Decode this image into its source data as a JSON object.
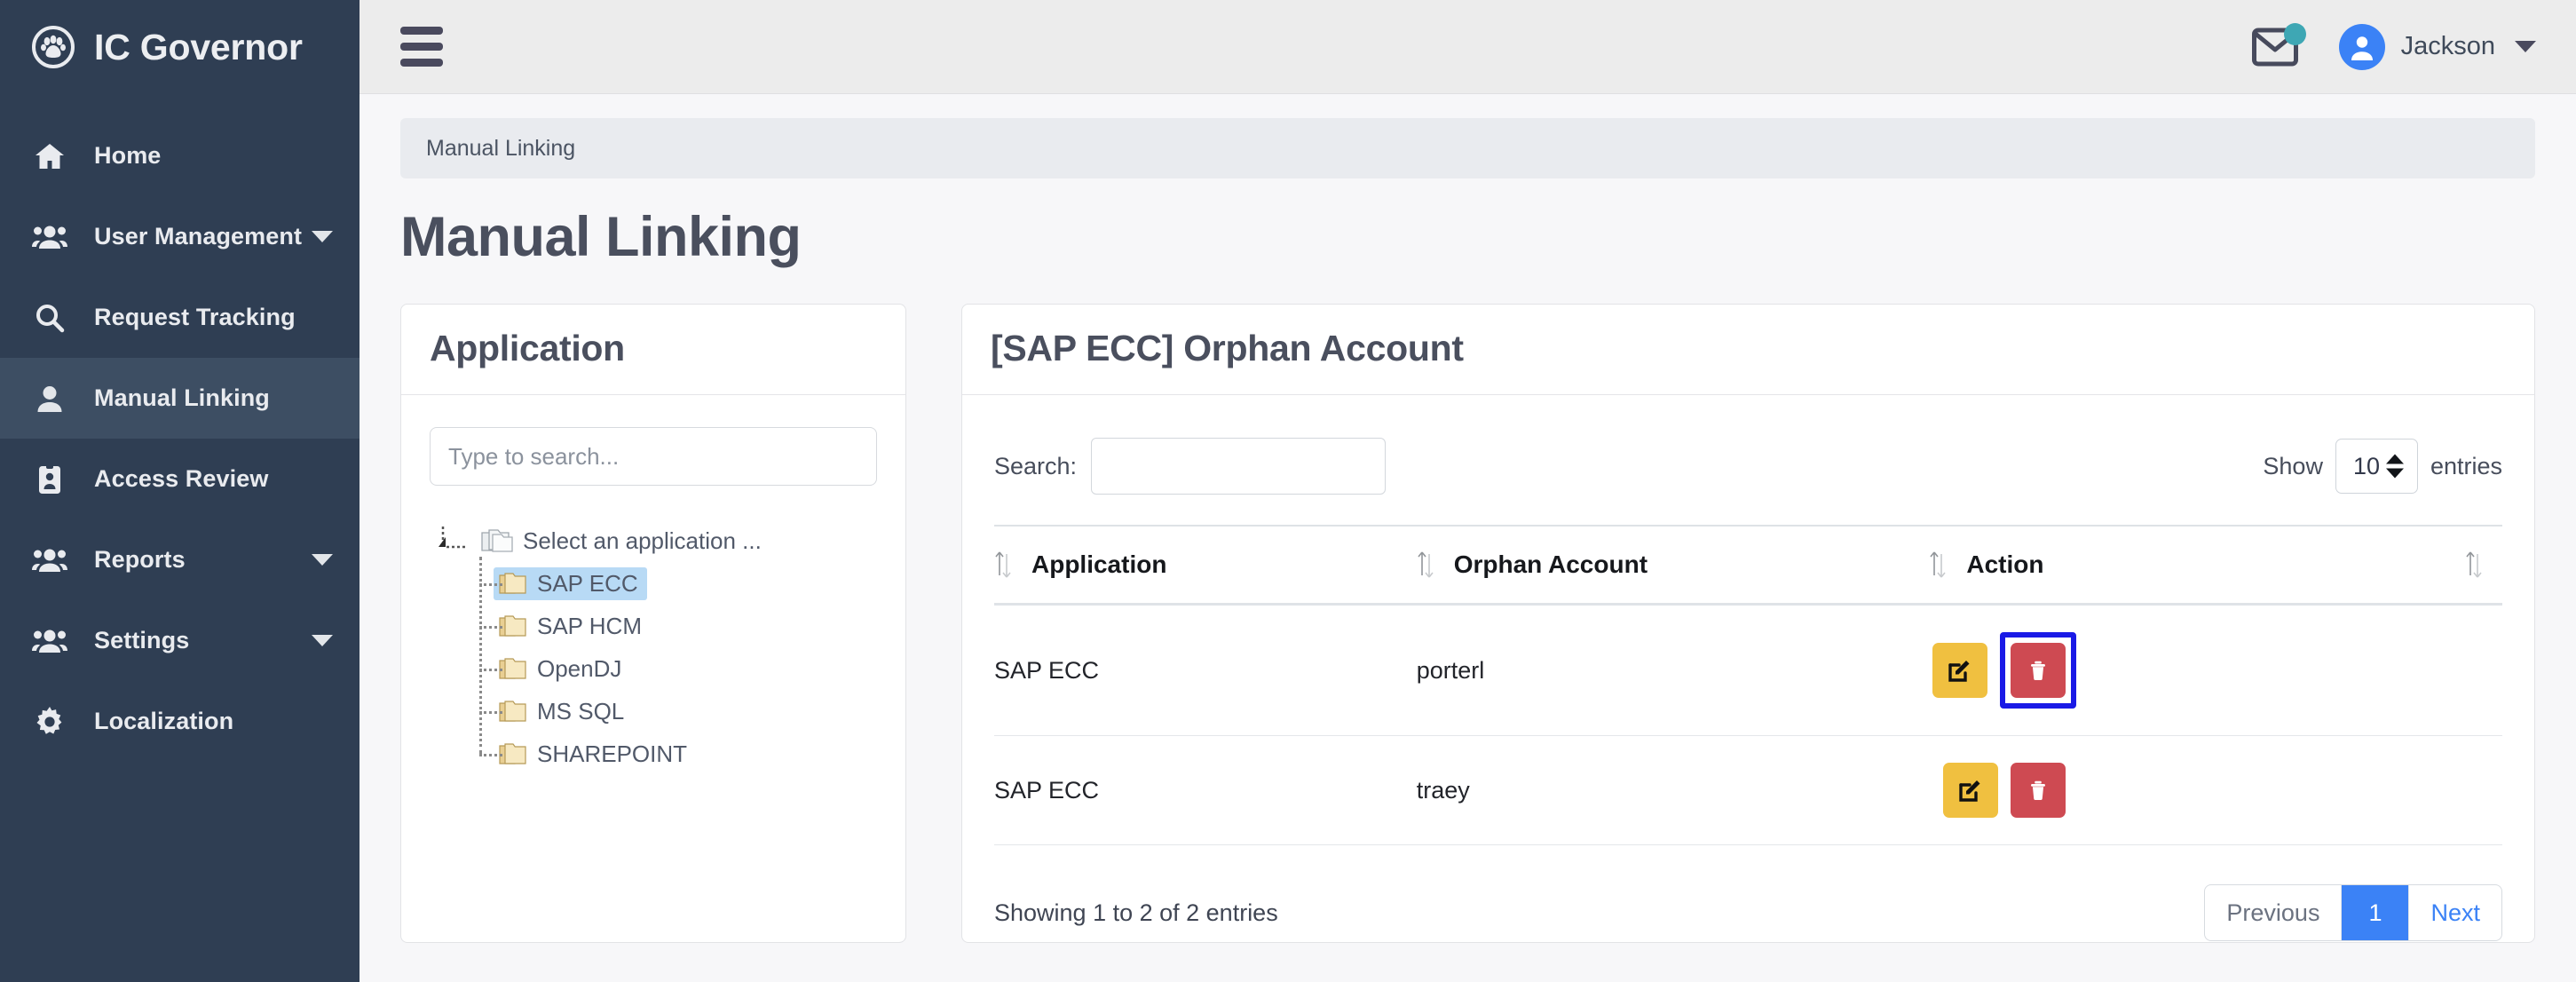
{
  "brand": {
    "title": "IC Governor",
    "logo_icon": "paw-circle-icon"
  },
  "sidebar": {
    "items": [
      {
        "label": "Home",
        "icon": "home-icon",
        "caret": false,
        "active": false
      },
      {
        "label": "User Management",
        "icon": "users-icon",
        "caret": true,
        "active": false
      },
      {
        "label": "Request Tracking",
        "icon": "search-icon",
        "caret": false,
        "active": false
      },
      {
        "label": "Manual Linking",
        "icon": "user-icon",
        "caret": false,
        "active": true
      },
      {
        "label": "Access Review",
        "icon": "id-badge-icon",
        "caret": false,
        "active": false
      },
      {
        "label": "Reports",
        "icon": "users-icon",
        "caret": true,
        "active": false
      },
      {
        "label": "Settings",
        "icon": "users-icon",
        "caret": true,
        "active": false
      },
      {
        "label": "Localization",
        "icon": "gear-icon",
        "caret": false,
        "active": false
      }
    ]
  },
  "topbar": {
    "menu_icon": "hamburger-icon",
    "mail_icon": "envelope-icon",
    "mail_badge_color": "#3ea7b4",
    "avatar_icon": "user-avatar-icon",
    "avatar_color": "#3b82f6",
    "user_name": "Jackson",
    "caret_icon": "chevron-down-icon"
  },
  "breadcrumb": {
    "text": "Manual Linking"
  },
  "page": {
    "title": "Manual Linking"
  },
  "application_panel": {
    "title": "Application",
    "search_placeholder": "Type to search...",
    "search_value": "",
    "tree": {
      "root_label": "Select an application ...",
      "nodes": [
        {
          "label": "SAP ECC",
          "selected": true
        },
        {
          "label": "SAP HCM",
          "selected": false
        },
        {
          "label": "OpenDJ",
          "selected": false
        },
        {
          "label": "MS SQL",
          "selected": false
        },
        {
          "label": "SHAREPOINT",
          "selected": false
        }
      ]
    }
  },
  "table_panel": {
    "title": "[SAP ECC] Orphan Account",
    "search_label": "Search:",
    "search_value": "",
    "show_label": "Show",
    "entries_label": "entries",
    "page_size": "10",
    "columns": [
      "Application",
      "Orphan Account",
      "Action",
      ""
    ],
    "rows": [
      {
        "application": "SAP ECC",
        "orphan_account": "porterl",
        "actions": [
          {
            "name": "edit",
            "icon": "pencil-square-icon",
            "color": "#f0c040",
            "focused": false
          },
          {
            "name": "delete",
            "icon": "trash-icon",
            "color": "#ce4a52",
            "focused": true
          }
        ]
      },
      {
        "application": "SAP ECC",
        "orphan_account": "traey",
        "actions": [
          {
            "name": "edit",
            "icon": "pencil-square-icon",
            "color": "#f0c040",
            "focused": false
          },
          {
            "name": "delete",
            "icon": "trash-icon",
            "color": "#ce4a52",
            "focused": false
          }
        ]
      }
    ],
    "showing_text": "Showing 1 to 2 of 2 entries",
    "pagination": {
      "previous": "Previous",
      "current": "1",
      "next": "Next"
    }
  },
  "colors": {
    "sidebar_bg": "#2f3e53",
    "sidebar_active_bg": "#3d4e63",
    "topbar_bg": "#ececec",
    "accent_blue": "#3b82f6",
    "focus_ring": "#1a1ae6",
    "tree_selected_bg": "#b8daf5"
  }
}
